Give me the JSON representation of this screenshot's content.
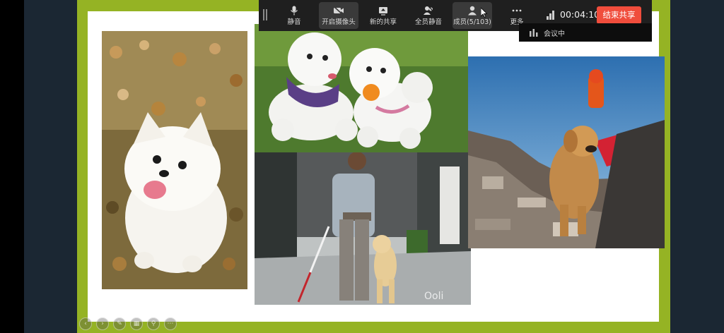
{
  "toolbar": {
    "buttons": [
      {
        "label": "静音",
        "icon": "microphone-icon"
      },
      {
        "label": "开启摄像头",
        "icon": "camera-off-icon"
      },
      {
        "label": "新的共享",
        "icon": "share-screen-icon"
      },
      {
        "label": "全员静音",
        "icon": "mute-all-icon"
      },
      {
        "label": "成员(5/103)",
        "icon": "members-icon"
      },
      {
        "label": "更多",
        "icon": "more-icon"
      }
    ],
    "timer": "00:04:10",
    "end_share_label": "结束共享"
  },
  "share_strip": {
    "label": "会议中"
  },
  "slide": {
    "photos": [
      {
        "name": "white-pomeranian"
      },
      {
        "name": "two-poodles"
      },
      {
        "name": "blind-man-guide-dog",
        "watermark": "Ooli"
      },
      {
        "name": "rescue-dog"
      }
    ]
  },
  "colors": {
    "frame_green": "#95b324",
    "end_button": "#f04d3c",
    "toolbar_bg": "#1f1f1f"
  }
}
